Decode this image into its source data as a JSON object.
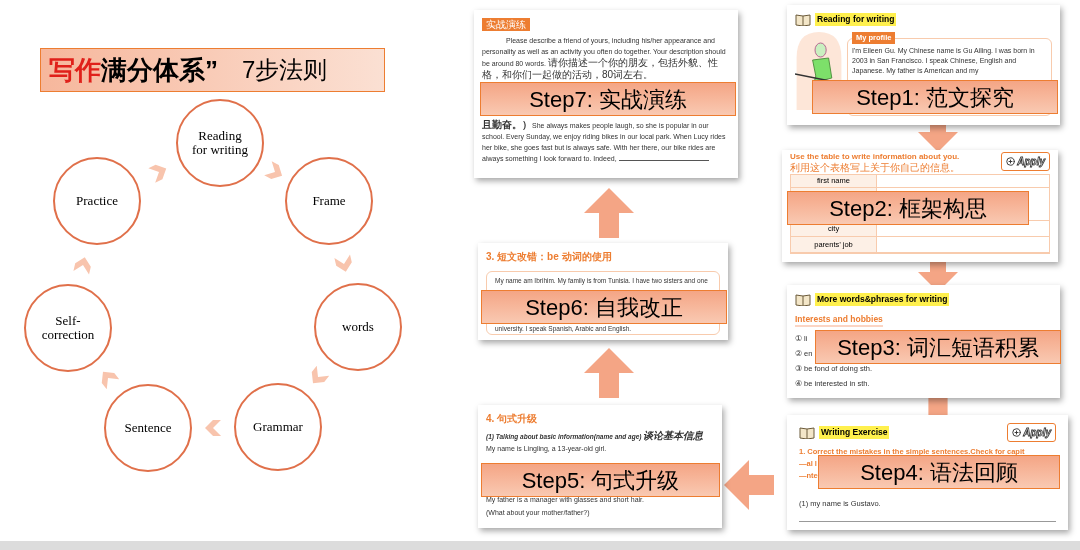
{
  "title": {
    "highlight": "写作",
    "rest": "满分体系”",
    "suffix": "7步法则"
  },
  "cycle": [
    {
      "label": "Reading for writing"
    },
    {
      "label": "Frame"
    },
    {
      "label": "words"
    },
    {
      "label": "Grammar"
    },
    {
      "label": "Sentence"
    },
    {
      "label": "Self-correction"
    },
    {
      "label": "Practice"
    }
  ],
  "steps": [
    {
      "kind": "exercise",
      "label": "Step7: 实战演练",
      "tag": "实战演练",
      "prompt": "Please describe a friend of yours, including his/her appearance and personality as well as an activity you often do together. Your description should be around 80 words.",
      "prompt_cn": "请你描述一个你的朋友，包括外貌、性格，和你们一起做的活动，80词左右。",
      "passage_cn": "且勤奋。）",
      "passage": "She always makes people laugh, so she is popular in our school. Every Sunday, we enjoy riding bikes in our local park. When Lucy rides her bike, she goes fast but is always safe. With her there, our bike rides are always something I look forward to. Indeed,"
    },
    {
      "kind": "profile",
      "label": "Step1: 范文探究",
      "header": "Reading for writing",
      "tag": "My profile",
      "text": "I'm Eileen Gu. My Chinese name is Gu Ailing. I was born in 2003 in San Francisco. I speak Chinese, English and Japanese. My father is American and my"
    },
    {
      "kind": "table",
      "label": "Step2: 框架构思",
      "heading": "Use the table to write information about you.",
      "heading_cn": "利用这个表格写上关于你自己的信息。",
      "badge": "Apply",
      "rows_top": [
        "first name"
      ],
      "rows_bottom": [
        "city",
        "parents’ job"
      ]
    },
    {
      "kind": "proofread",
      "label": "Step6: 自我改正",
      "heading": "3. 短文改错：be 动词的使用",
      "lines_top": [
        "My name am Ibrihim. My family is from Tunisia. I have two sisters and one"
      ],
      "lines_bottom": [
        "university. I speak Spanish, Arabic and English."
      ]
    },
    {
      "kind": "phrases",
      "label": "Step3: 词汇短语积累",
      "header": "More words&phrases for writing",
      "subheading": "Interests and hobbies",
      "items": [
        "① li",
        "② en",
        "③ be fond of doing sth.",
        "④ be interested in sth."
      ]
    },
    {
      "kind": "upgrade",
      "label": "Step5: 句式升级",
      "heading": "4. 句式升级",
      "subheading": "(1) Talking about basic information(name and age)",
      "subheading_cn": "谈论基本信息",
      "lines_top": [
        "My name is Lingling, a 13-year-old girl."
      ],
      "lines_bottom": [
        "My father is a manager with glasses and short hair.",
        "(What about your mother/father?)"
      ]
    },
    {
      "kind": "correction",
      "label": "Step4: 语法回顾",
      "header": "Writing Exercise",
      "badge": "Apply",
      "instructions": [
        "1. Correct the mistakes in the simple sentences.Check for capit",
        "—al l",
        "—nte"
      ],
      "sentence": "(1) my name is Gustavo."
    }
  ]
}
